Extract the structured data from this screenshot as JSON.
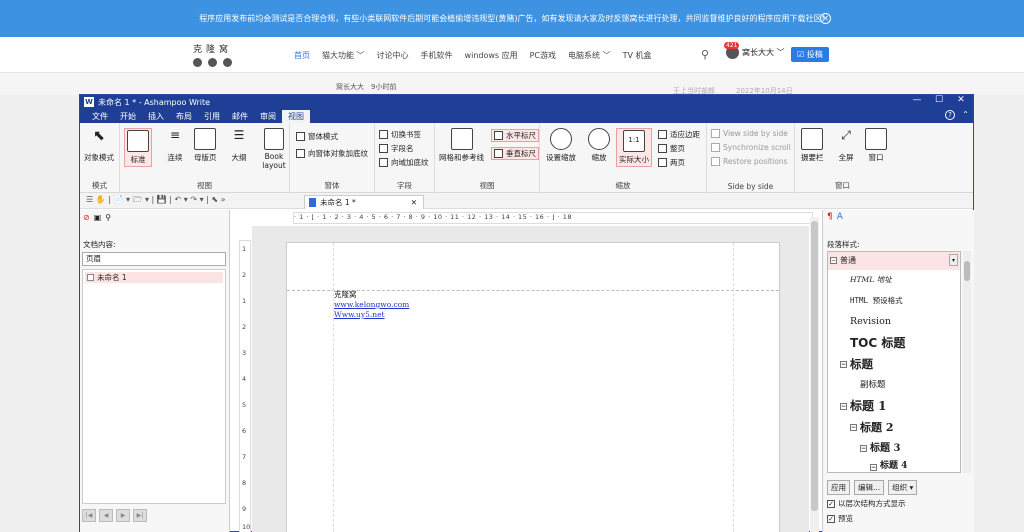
{
  "banner": {
    "text": "程序应用发布前均会测试是否合理合规，有些小类联网软件后期可能会植偷增违规型(黄赌)广告，如有发现请大家及时反馈窝长进行处理，共同监督维护良好的程序应用下载社区!",
    "close": "✕"
  },
  "site": {
    "logo": "克隆窝",
    "nav": [
      "首页",
      "猫大功能 ﹀",
      "讨论中心",
      "手机软件",
      "windows 应用",
      "PC游戏",
      "电脑系统 ﹀",
      "TV 机盒"
    ],
    "search_icon": "search-icon",
    "badge": "421",
    "user": "窝长大大 ﹀",
    "post_button": "☑ 投稿"
  },
  "bg": {
    "author": "窝长大大　9小时前",
    "right": "王上当时部郎　　　2022年10月14日"
  },
  "window": {
    "logo": "W",
    "title": "未命名 1 * - Ashampoo Write",
    "controls": [
      "—",
      "☐",
      "✕"
    ]
  },
  "menu": {
    "items": [
      "文件",
      "开始",
      "插入",
      "布局",
      "引用",
      "邮件",
      "审阅",
      "视图"
    ],
    "active": 7,
    "help": "?",
    "collapse": "⌃"
  },
  "ribbon": {
    "groups": {
      "mode": "模式",
      "view": "视图",
      "window": "窗体",
      "field": "字段",
      "view2": "视图",
      "zoom": "缩放",
      "side": "Side by side",
      "win": "窗口"
    },
    "buttons": {
      "object_mode": "对象模式",
      "standard": "标准",
      "continuous": "连续",
      "master": "母版页",
      "outline": "大纲",
      "book": "Book layout",
      "form_mode": "窗体模式",
      "form_shading": "向窗体对象加底纹",
      "toggle_bookmark": "切换书签",
      "field_name": "字段名",
      "field_shading": "向域加底纹",
      "grid": "网格和参考线",
      "h_ruler": "水平标尺",
      "v_ruler": "垂直标尺",
      "set_zoom": "设置缩放",
      "zoom": "缩放",
      "actual": "实际大小",
      "fit_margins": "适应边距",
      "whole_page": "整页",
      "two_pages": "两页",
      "view_sbs": "View side by side",
      "sync_scroll": "Synchronize scroll",
      "restore_pos": "Restore positions",
      "toolbars": "摄要栏",
      "fullscreen": "全屏",
      "window": "窗口"
    }
  },
  "toolbar": {
    "icons": "☰  ✋ | 📄 ▾  🗁 ▾ | 💾 | ↶ ▾ ↷ ▾ | ⬉ »"
  },
  "doc_tab": {
    "label": "未命名 1 *",
    "close": "✕"
  },
  "left_pane": {
    "label": "文档内容:",
    "select": "页眉",
    "items": [
      "未命名 1"
    ],
    "nav": [
      "|◀",
      "◀",
      "▶",
      "▶|"
    ]
  },
  "ruler": {
    "text": "· 1 · ⌊ · 1 · 2 · 3 · 4 · 5 · 6 · 7 · 8 · 9 · 10 · 11 · 12 · 13 · 14 · 15 · 16 · ⌋ · 18",
    "vticks": [
      "1",
      "2",
      "1",
      "2",
      "3",
      "4",
      "5",
      "6",
      "7",
      "8",
      "9",
      "10"
    ]
  },
  "document": {
    "lines": [
      "克隆窝",
      "www.kelongwo.com",
      "Www.uy5.net"
    ]
  },
  "right_pane": {
    "label": "段落样式:",
    "styles": [
      {
        "name": "普通"
      },
      {
        "name": "HTML 地址"
      },
      {
        "name": "HTML 预设格式"
      },
      {
        "name": "Revision"
      },
      {
        "name": "TOC 标题"
      },
      {
        "name": "标题"
      },
      {
        "name": "副标题"
      },
      {
        "name": "标题 1"
      },
      {
        "name": "标题 2"
      },
      {
        "name": "标题 3"
      },
      {
        "name": "标题 4"
      }
    ],
    "buttons": [
      "应用",
      "编辑...",
      "组织 ▾"
    ],
    "checks": [
      "以层次结构方式显示",
      "预览"
    ]
  }
}
